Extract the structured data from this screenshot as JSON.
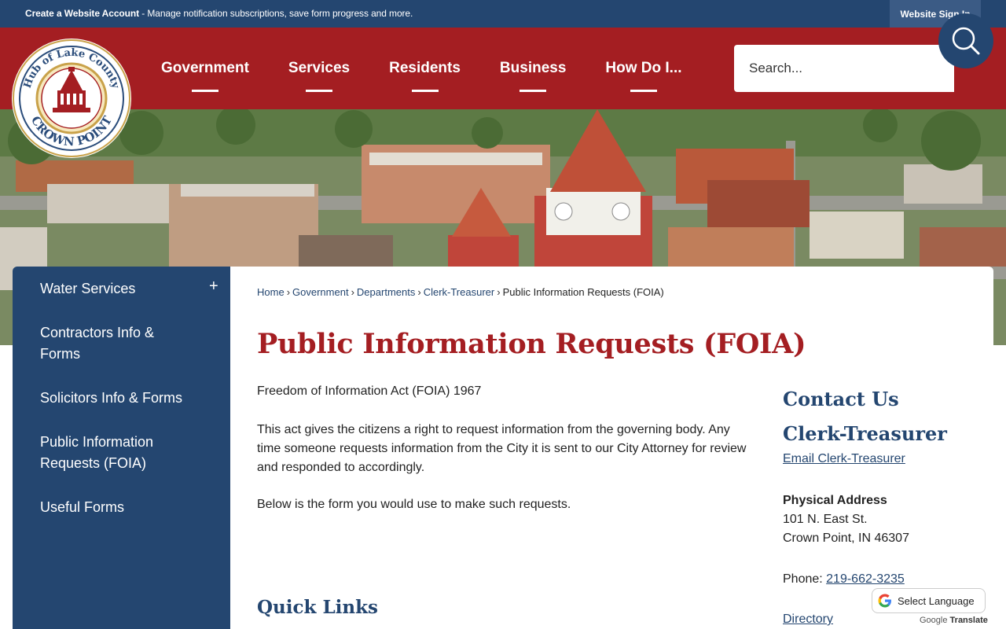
{
  "topbar": {
    "account_link": "Create a Website Account",
    "account_desc": " - Manage notification subscriptions, save form progress and more.",
    "signin": "Website Sign In"
  },
  "logo": {
    "top_text": "Hub of Lake County",
    "bottom_text": "CROWN POINT"
  },
  "nav": {
    "items": [
      "Government",
      "Services",
      "Residents",
      "Business",
      "How Do I..."
    ]
  },
  "search": {
    "placeholder": "Search..."
  },
  "sidebar": {
    "items": [
      {
        "label": "Water Services",
        "expand": "+"
      },
      {
        "label": "Contractors Info & Forms"
      },
      {
        "label": "Solicitors Info & Forms"
      },
      {
        "label": "Public Information Requests (FOIA)"
      },
      {
        "label": "Useful Forms"
      }
    ]
  },
  "breadcrumb": {
    "items": [
      "Home",
      "Government",
      "Departments",
      "Clerk-Treasurer"
    ],
    "current": "Public Information Requests (FOIA)",
    "sep": "›"
  },
  "page": {
    "title": "Public Information Requests (FOIA)",
    "subheading": "Freedom of Information Act (FOIA) 1967",
    "para1": "This act gives the citizens a right to request information from the governing body.  Any time someone requests information from the City it is sent to our City Attorney for review and responded to accordingly.",
    "para2": "Below is the form you would use to make such requests.",
    "quick_links": "Quick Links"
  },
  "contact": {
    "heading": "Contact Us",
    "dept": "Clerk-Treasurer",
    "email_link": "Email Clerk-Treasurer",
    "address_label": "Physical Address",
    "address_line1": "101 N. East St.",
    "address_line2": "Crown Point, IN 46307",
    "phone_label": "Phone: ",
    "phone": "219-662-3235",
    "directory": "Directory"
  },
  "translate": {
    "label": "Select Language",
    "powered_google": "Google",
    "powered_translate": "Translate"
  },
  "colors": {
    "navy": "#244670",
    "red": "#a41e22"
  }
}
